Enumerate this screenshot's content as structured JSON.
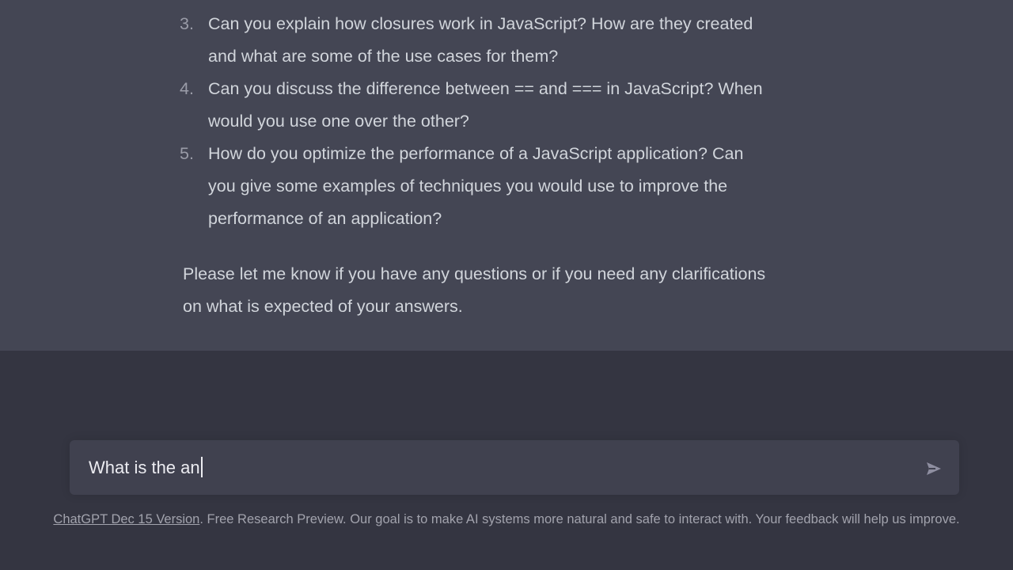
{
  "conversation": {
    "list_items": [
      {
        "number": "3.",
        "text": "Can you explain how closures work in JavaScript? How are they created\nand what are some of the use cases for them?"
      },
      {
        "number": "4.",
        "text": "Can you discuss the difference between == and === in JavaScript? When\nwould you use one over the other?"
      },
      {
        "number": "5.",
        "text": "How do you optimize the performance of a JavaScript application? Can\nyou give some examples of techniques you would use to improve the\nperformance of an application?"
      }
    ],
    "closing_text": "Please let me know if you have any questions or if you need any clarifications\non what is expected of your answers."
  },
  "composer": {
    "input_value": "What is the an",
    "send_icon": "paper-plane-icon"
  },
  "footer": {
    "version_link": "ChatGPT Dec 15 Version",
    "text": ". Free Research Preview. Our goal is to make AI systems more natural and safe to interact with. Your feedback will help us improve."
  },
  "colors": {
    "page_background": "#343541",
    "assistant_background": "#444654",
    "text": "#d1d5db",
    "input_background": "#40414f",
    "footer_text": "#a2a3ad"
  }
}
